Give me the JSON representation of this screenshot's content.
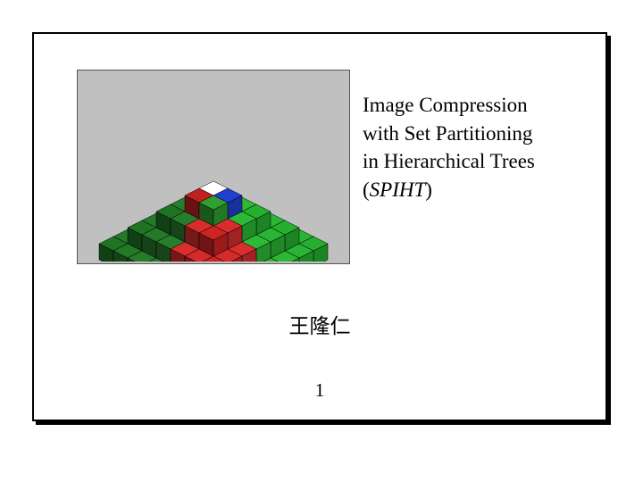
{
  "title": {
    "line1": "Image Compression",
    "line2": "with Set Partitioning",
    "line3": "in Hierarchical Trees",
    "line4_open": "(",
    "line4_acronym": "SPIHT",
    "line4_close": ")"
  },
  "author": "王隆仁",
  "page_number": "1",
  "figure": {
    "description": "3D color cube pyramid (RGB color space visualization)",
    "background": "#c0c0c0"
  }
}
